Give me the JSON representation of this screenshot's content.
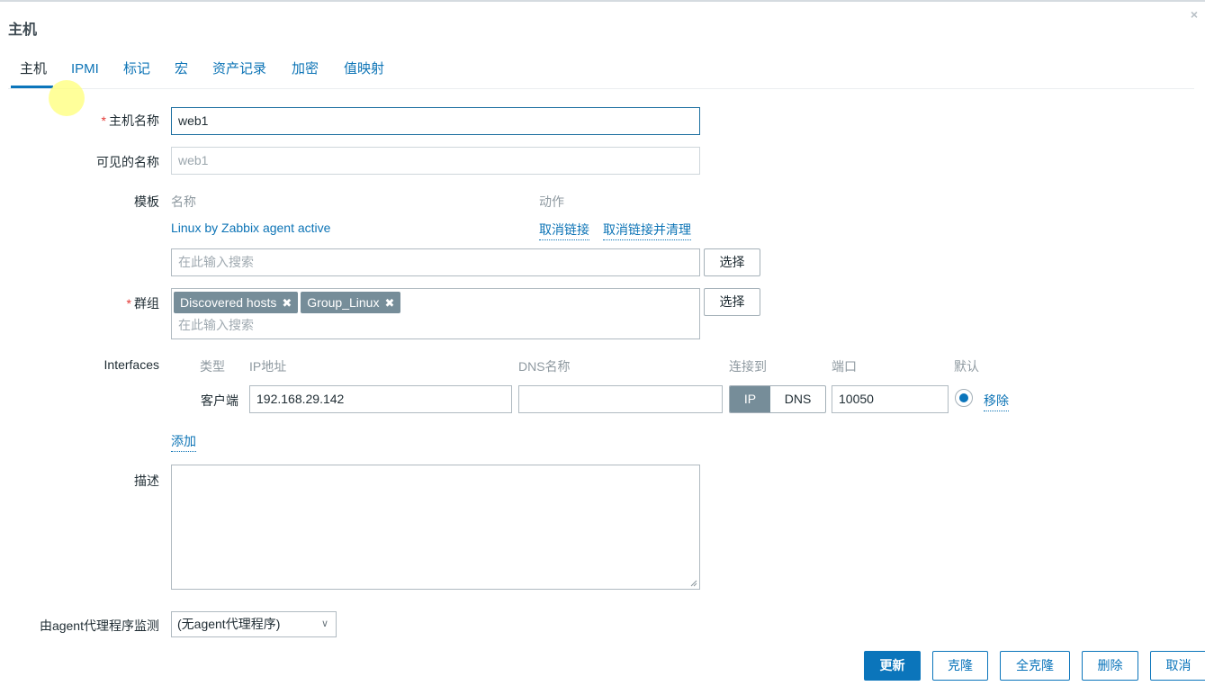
{
  "window": {
    "title": "主机",
    "close_icon": "×"
  },
  "tabs": [
    {
      "label": "主机",
      "active": true
    },
    {
      "label": "IPMI"
    },
    {
      "label": "标记"
    },
    {
      "label": "宏"
    },
    {
      "label": "资产记录"
    },
    {
      "label": "加密"
    },
    {
      "label": "值映射"
    }
  ],
  "form": {
    "host_name": {
      "label": "主机名称",
      "required": "*",
      "value": "web1"
    },
    "visible_name": {
      "label": "可见的名称",
      "value": "web1"
    },
    "templates": {
      "label": "模板",
      "col_name": "名称",
      "col_action": "动作",
      "items": [
        {
          "name": "Linux by Zabbix agent active",
          "unlink": "取消链接",
          "unlink_clear": "取消链接并清理"
        }
      ],
      "search_placeholder": "在此输入搜索",
      "select_label": "选择"
    },
    "groups": {
      "label": "群组",
      "required": "*",
      "tags": [
        {
          "label": "Discovered hosts",
          "remove_icon": "✖"
        },
        {
          "label": "Group_Linux",
          "remove_icon": "✖"
        }
      ],
      "search_placeholder": "在此输入搜索",
      "select_label": "选择"
    },
    "interfaces": {
      "label": "Interfaces",
      "headers": {
        "type": "类型",
        "ip": "IP地址",
        "dns": "DNS名称",
        "connect_to": "连接到",
        "port": "端口",
        "default": "默认"
      },
      "rows": [
        {
          "type": "客户端",
          "ip": "192.168.29.142",
          "dns": "",
          "connect_options": [
            "IP",
            "DNS"
          ],
          "connect_selected": "IP",
          "port": "10050",
          "default": true,
          "remove": "移除"
        }
      ],
      "add": "添加"
    },
    "description": {
      "label": "描述",
      "value": ""
    },
    "proxy": {
      "label": "由agent代理程序监测",
      "selected": "(无agent代理程序)"
    }
  },
  "footer": {
    "update": "更新",
    "clone": "克隆",
    "full_clone": "全克隆",
    "delete": "删除",
    "cancel": "取消"
  }
}
